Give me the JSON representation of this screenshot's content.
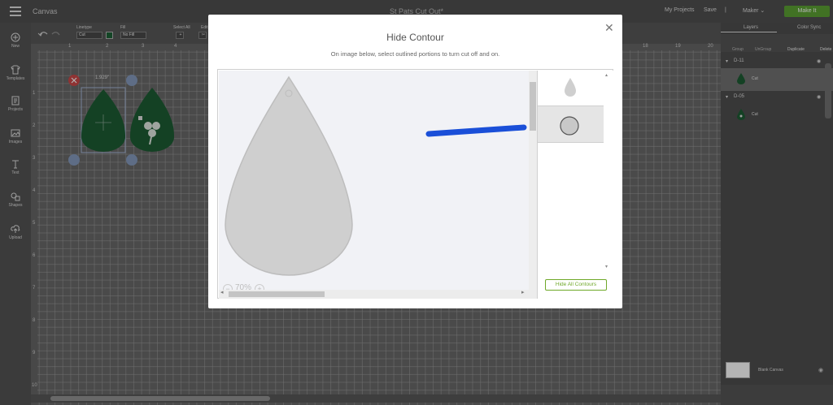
{
  "topbar": {
    "app_title": "Canvas",
    "project_name": "St Pats Cut Out*",
    "my_projects": "My Projects",
    "save": "Save",
    "separator": "|",
    "machine": "Maker",
    "make_it": "Make It"
  },
  "toolbar": {
    "linetype_label": "Linetype",
    "linetype_value": "Cut",
    "fill_label": "Fill",
    "fill_value": "No Fill",
    "select_all_label": "Select All",
    "edit_label": "Edit",
    "swatch_color": "#0a5526"
  },
  "leftbar": {
    "items": [
      {
        "label": "New",
        "icon": "plus-circle-icon"
      },
      {
        "label": "Templates",
        "icon": "tshirt-icon"
      },
      {
        "label": "Projects",
        "icon": "projects-icon"
      },
      {
        "label": "Images",
        "icon": "image-icon"
      },
      {
        "label": "Text",
        "icon": "text-icon"
      },
      {
        "label": "Shapes",
        "icon": "shapes-icon"
      },
      {
        "label": "Upload",
        "icon": "upload-icon"
      }
    ]
  },
  "canvas": {
    "ruler_top": [
      "1",
      "2",
      "3",
      "4",
      "18",
      "19",
      "20"
    ],
    "ruler_left": [
      "1",
      "2",
      "3",
      "4",
      "5",
      "6",
      "7",
      "8",
      "9",
      "10"
    ],
    "dimension": "1.929\""
  },
  "layers": {
    "tab_layers": "Layers",
    "tab_color_sync": "Color Sync",
    "tools": [
      "Group",
      "UnGroup",
      "Duplicate",
      "Delete"
    ],
    "groups": [
      {
        "name": "D-11",
        "child": "Cut"
      },
      {
        "name": "D-05",
        "child": "Cut"
      }
    ],
    "blank_canvas": "Blank Canvas",
    "layer_color": "#0a5526"
  },
  "modal": {
    "title": "Hide Contour",
    "subtitle": "On image below, select outlined portions to turn cut off and on.",
    "zoom": "70%",
    "hide_all": "Hide All Contours",
    "accent_color": "#6fa829",
    "arrow_color": "#1a4fd8"
  }
}
